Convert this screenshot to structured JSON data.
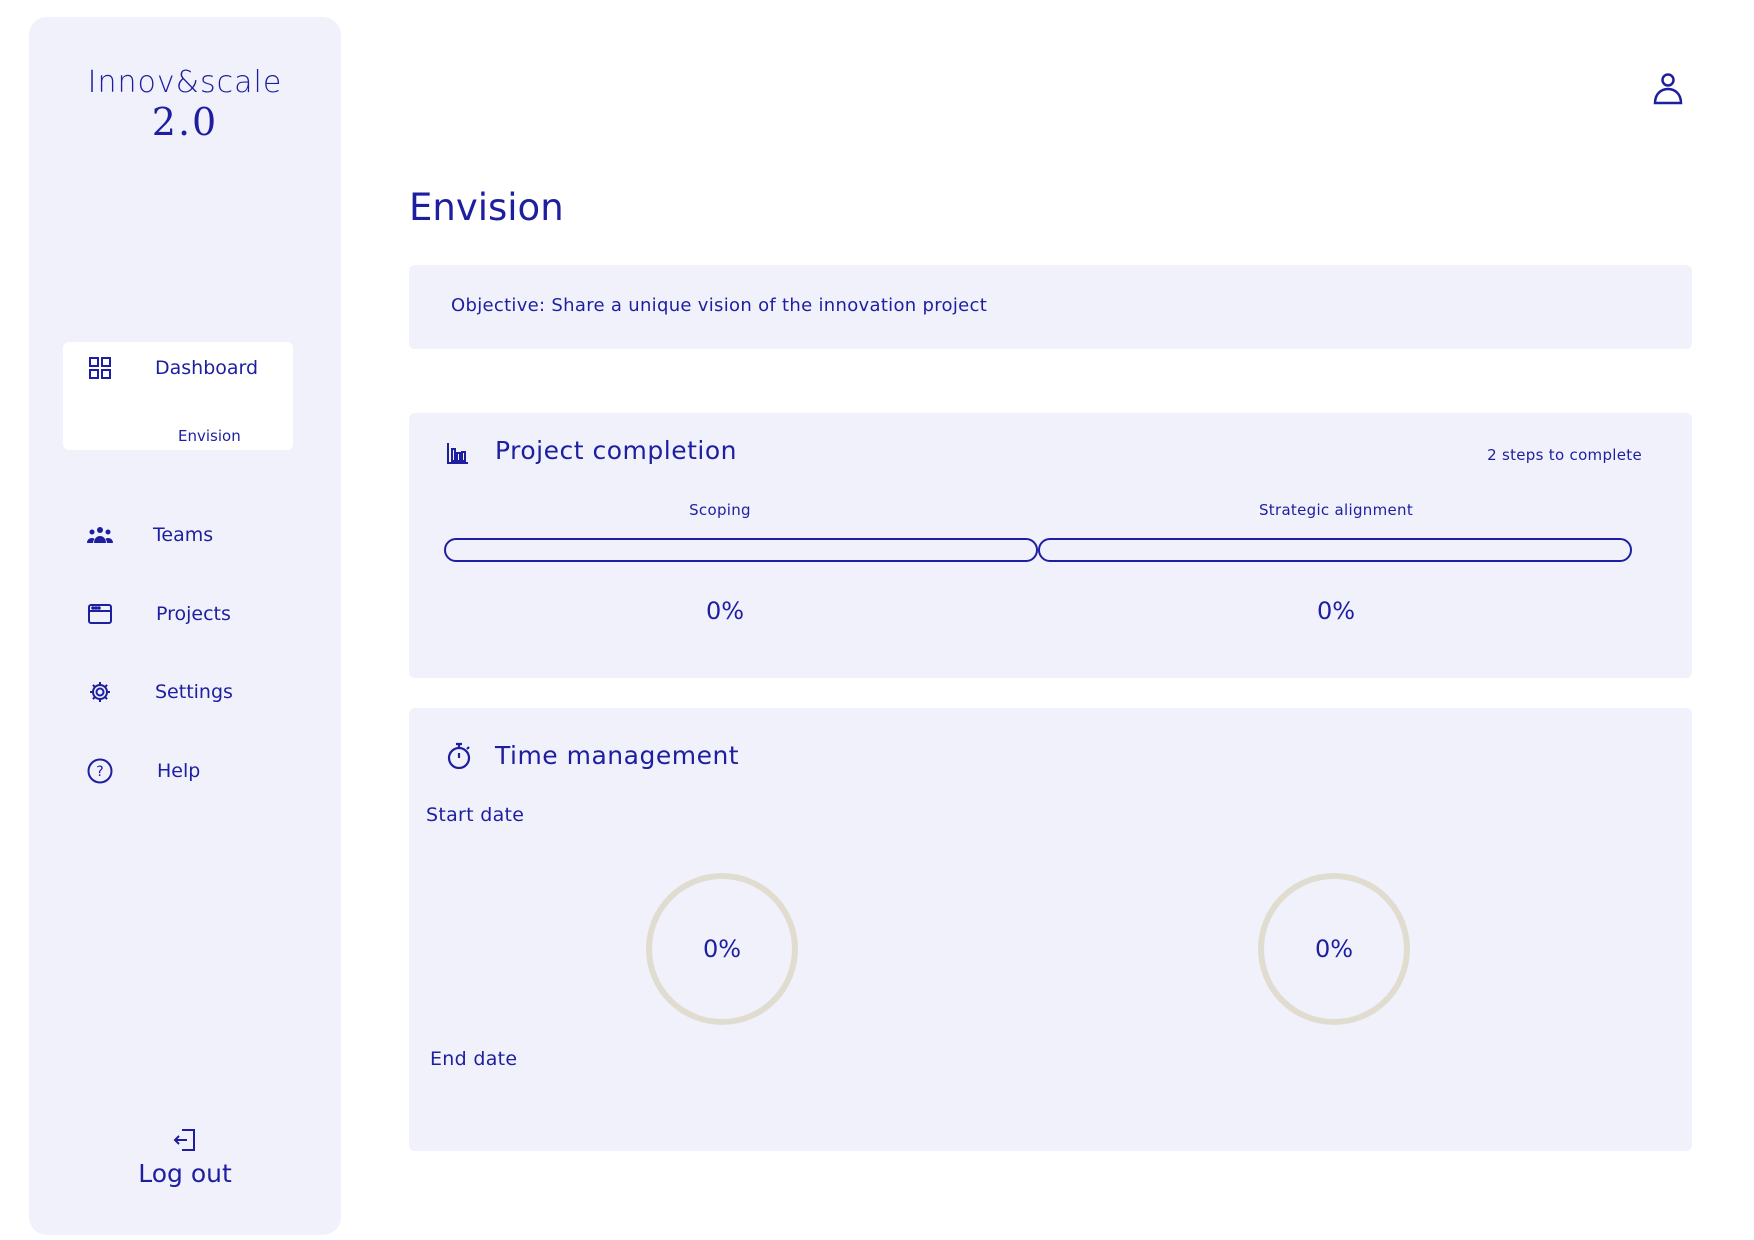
{
  "app": {
    "logo_name": "Innov&scale",
    "logo_version": "2.0"
  },
  "sidebar": {
    "items": [
      {
        "label": "Dashboard",
        "icon": "grid-icon",
        "active": true
      },
      {
        "label": "Teams",
        "icon": "team-icon"
      },
      {
        "label": "Projects",
        "icon": "browser-window-icon"
      },
      {
        "label": "Settings",
        "icon": "gear-icon"
      },
      {
        "label": "Help",
        "icon": "question-circle-icon"
      }
    ],
    "sub_item": "Envision",
    "logout_label": "Log out",
    "logout_icon": "logout-icon"
  },
  "header": {
    "user_icon": "user-icon"
  },
  "page": {
    "title": "Envision",
    "objective": "Objective: Share a unique vision of the innovation project"
  },
  "completion": {
    "title": "Project completion",
    "icon": "bar-chart-icon",
    "steps_count": "2 steps to complete",
    "steps": [
      {
        "label": "Scoping",
        "percent_text": "0%",
        "progress": 0
      },
      {
        "label": "Strategic alignment",
        "percent_text": "0%",
        "progress": 0
      }
    ]
  },
  "time": {
    "title": "Time management",
    "icon": "stopwatch-icon",
    "start_label": "Start date",
    "end_label": "End date",
    "gauges": [
      {
        "percent_text": "0%",
        "progress": 0
      },
      {
        "percent_text": "0%",
        "progress": 0
      }
    ]
  },
  "colors": {
    "accent": "#1d1fa0",
    "panel": "#f0f1fa",
    "gauge_track": "#e0ddd0"
  }
}
